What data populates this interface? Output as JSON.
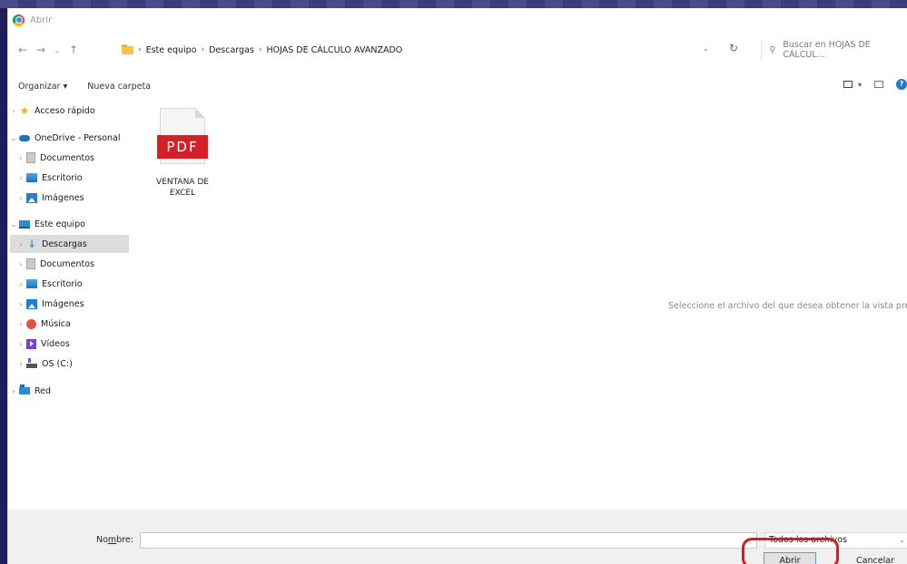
{
  "window": {
    "title": "Abrir"
  },
  "address": {
    "crumbs": [
      "Este equipo",
      "Descargas",
      "HOJAS DE CÁLCULO AVANZADO"
    ],
    "search_placeholder": "Buscar en HOJAS DE CÁLCUL..."
  },
  "toolbar": {
    "organize_label": "Organizar",
    "new_folder_label": "Nueva carpeta"
  },
  "sidebar": {
    "items": [
      {
        "label": "Acceso rápido",
        "icon": "star-icon"
      },
      {
        "label": "OneDrive - Personal",
        "icon": "cloud-icon"
      },
      {
        "label": "Documentos",
        "icon": "documents-icon"
      },
      {
        "label": "Escritorio",
        "icon": "desktop-icon"
      },
      {
        "label": "Imágenes",
        "icon": "pictures-icon"
      },
      {
        "label": "Este equipo",
        "icon": "computer-icon"
      },
      {
        "label": "Descargas",
        "icon": "download-icon",
        "selected": true
      },
      {
        "label": "Documentos",
        "icon": "documents-icon"
      },
      {
        "label": "Escritorio",
        "icon": "desktop-icon"
      },
      {
        "label": "Imágenes",
        "icon": "pictures-icon"
      },
      {
        "label": "Música",
        "icon": "music-icon"
      },
      {
        "label": "Vídeos",
        "icon": "videos-icon"
      },
      {
        "label": "OS (C:)",
        "icon": "drive-icon"
      },
      {
        "label": "Red",
        "icon": "network-icon"
      }
    ]
  },
  "files": [
    {
      "name": "VENTANA DE EXCEL",
      "badge": "PDF",
      "type": "pdf"
    }
  ],
  "preview": {
    "message": "Seleccione el archivo del que desea obtener la vista previa."
  },
  "footer": {
    "name_label_prefix": "No",
    "name_label_underlined": "m",
    "name_label_suffix": "bre:",
    "name_value": "",
    "filter_value": "Todos los archivos",
    "open_label_underlined": "A",
    "open_label_rest": "brir",
    "cancel_label": "Cancelar"
  },
  "colors": {
    "highlight": "#e4161b",
    "pdf_red": "#d42027",
    "selected_row": "#dcdcdc",
    "background": "#1f1d5c"
  }
}
